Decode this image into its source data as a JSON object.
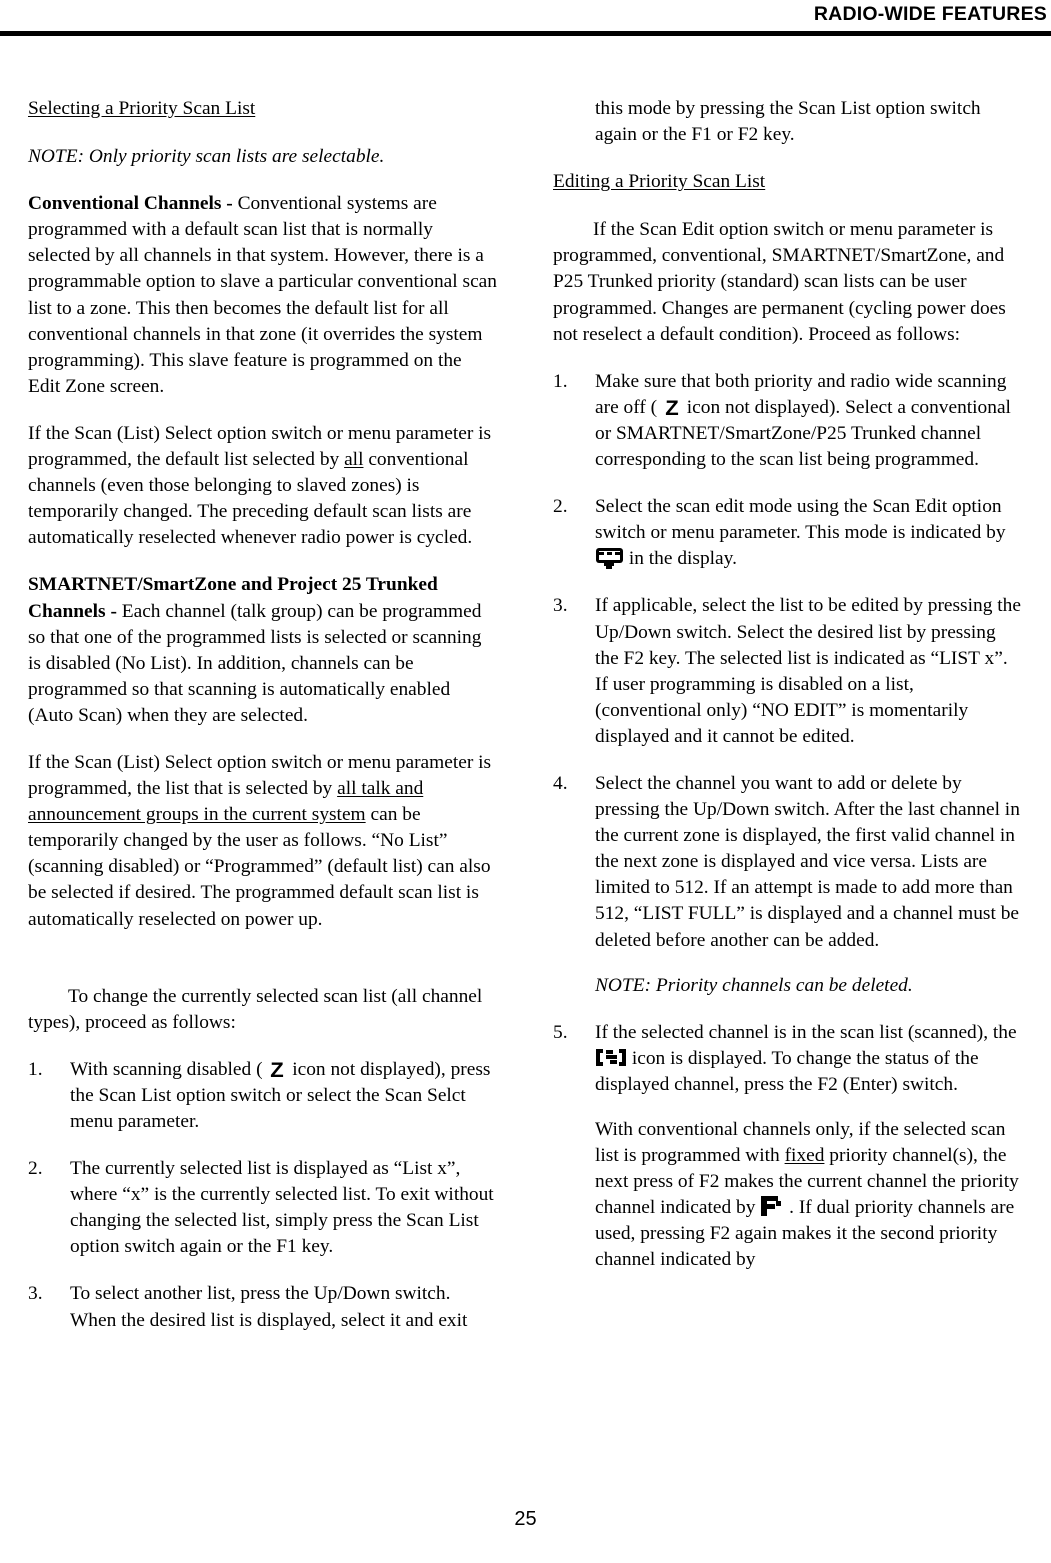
{
  "header": {
    "title": "RADIO-WIDE FEATURES"
  },
  "footer": {
    "page_number": "25"
  },
  "icons": {
    "scan": "scan-z-icon",
    "scan_edit": "scan-edit-icon",
    "scanned": "scanned-bracket-s-icon",
    "priority": "priority-p-icon"
  },
  "left_column": {
    "heading": "Selecting a Priority Scan List",
    "note": "NOTE: Only priority scan lists are selectable.",
    "conventional": {
      "lead_in": "Conventional Channels - ",
      "body": "Conventional systems are programmed with a default scan list that is normally selected by all channels in that system. However, there is a programmable option to slave a particular conventional scan list to a zone. This then becomes the default list for all conventional channels in that zone (it overrides the system programming). This slave feature is programmed on the Edit Zone screen."
    },
    "scan_select_conventional": {
      "part1": "If the Scan (List) Select option switch or menu parameter is programmed, the default list selected by ",
      "underlined": "all",
      "part2": " conventional channels (even those belonging to slaved zones) is temporarily changed. The preceding default scan lists are automatically reselected whenever radio power is cycled."
    },
    "trunked": {
      "lead_in": "SMARTNET/SmartZone and Project 25 Trunked Channels - ",
      "body": "Each channel (talk group) can be programmed so that one of the programmed lists is selected or scanning is disabled (No List). In addition, channels can be programmed so that scanning is automatically enabled (Auto Scan) when they are selected."
    },
    "scan_select_trunked": {
      "part1": "If the Scan (List) Select option switch or menu parameter is programmed, the list that is selected by ",
      "underlined": "all talk and announcement groups in the current system",
      "part2": " can be temporarily changed by the user as follows. “No List” (scanning disabled) or “Programmed” (default list) can also be selected if desired. The programmed default scan list is automatically reselected on power up."
    },
    "procedure_intro": "To change the currently selected scan list (all channel types), proceed as follows:",
    "steps": [
      {
        "num": "1.",
        "part1": "With scanning disabled ( ",
        "icon": "scan",
        "part2": " icon not displayed), press the Scan List option switch or select the Scan Selct menu parameter."
      },
      {
        "num": "2.",
        "text": "The currently selected list is displayed as “List x”, where “x” is the currently selected list. To exit without changing the selected list, simply press the Scan List option switch again or the F1 key."
      },
      {
        "num": "3.",
        "text": "To select another list, press the Up/Down switch. When the desired list is displayed, select it and exit"
      }
    ]
  },
  "right_column": {
    "continuation": "this mode by pressing the Scan List option switch again or the F1 or F2 key.",
    "heading": "Editing a Priority Scan List",
    "intro": "If the Scan Edit option switch or menu parameter is programmed, conventional, SMARTNET/SmartZone, and P25 Trunked priority (standard) scan lists can be user programmed. Changes are permanent (cycling power does not reselect a default condition). Proceed as follows:",
    "steps": [
      {
        "num": "1.",
        "part1": "Make sure that both priority and radio wide scanning are off ( ",
        "icon": "scan",
        "part2": " icon not displayed). Select a conventional or SMARTNET/SmartZone/P25 Trunked channel corresponding to the scan list being programmed."
      },
      {
        "num": "2.",
        "part1": "Select the scan edit mode using the Scan Edit option switch or menu parameter. This mode is indicated by ",
        "icon": "scan_edit",
        "part2": " in the display."
      },
      {
        "num": "3.",
        "text": "If applicable, select the list to be edited by pressing the Up/Down switch. Select the desired list by pressing the F2 key. The selected list is indicated as “LIST x”. If user programming is disabled on a list, (conventional only) “NO EDIT” is momentarily displayed and it cannot be edited."
      },
      {
        "num": "4.",
        "text": "Select the channel you want to add or delete by pressing the Up/Down switch. After the last channel in the current zone is displayed, the first valid channel in the next zone is displayed and vice versa. Lists are limited to 512. If an attempt is made to add more than 512, “LIST FULL” is displayed and a channel must be deleted before another can be added.",
        "note": "NOTE: Priority channels can be deleted."
      },
      {
        "num": "5.",
        "part1": "If the selected channel is in the scan list (scanned), the ",
        "icon": "scanned",
        "part2": " icon is displayed. To change the status of the displayed channel, press the F2 (Enter) switch.",
        "sub_part1": "With conventional channels only, if the selected scan list is programmed with ",
        "sub_underlined": "fixed",
        "sub_part2": " priority channel(s), the next press of F2 makes the current channel the priority channel indicated by ",
        "sub_icon": "priority",
        "sub_part3": " . If dual priority channels are used, pressing F2 again makes it the second priority channel indicated by"
      }
    ]
  }
}
